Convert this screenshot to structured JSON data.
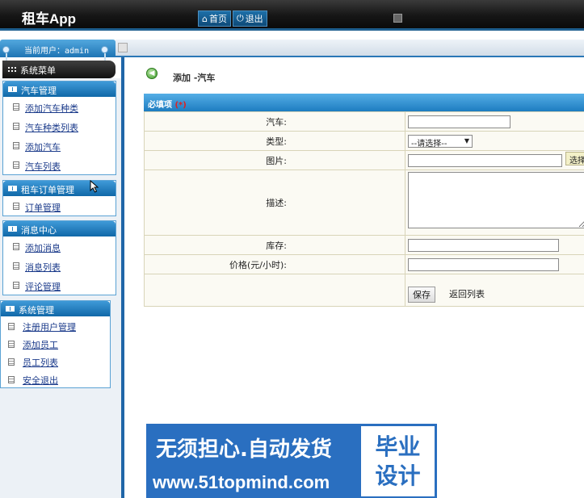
{
  "app": {
    "title": "租车App"
  },
  "topnav": {
    "home": "首页",
    "logout": "退出"
  },
  "user": {
    "label": "当前用户：admin"
  },
  "sidebar": {
    "title": "系统菜单",
    "groups": [
      {
        "title": "汽车管理",
        "items": [
          "添加汽车种类",
          "汽车种类列表",
          "添加汽车",
          "汽车列表"
        ]
      },
      {
        "title": "租车订单管理",
        "items": [
          "订单管理"
        ]
      },
      {
        "title": "消息中心",
        "items": [
          "添加消息",
          "消息列表",
          "评论管理"
        ]
      },
      {
        "title": "系统管理",
        "items": [
          "注册用户管理",
          "添加员工",
          "员工列表",
          "安全退出"
        ]
      }
    ]
  },
  "main": {
    "breadcrumb": "添加 -汽车",
    "required_title": "必填项",
    "required_mark": "(*)",
    "fields": {
      "car": "汽车:",
      "type": "类型:",
      "image": "图片:",
      "description": "描述:",
      "stock": "库存:",
      "price": "价格(元/小时):"
    },
    "type_select": "--请选择--",
    "pick_button": "选择",
    "save_button": "保存",
    "back_link": "返回列表"
  },
  "watermark": {
    "line1": "无须担心.自动发货",
    "line2": "www.51topmind.com",
    "badge_line1": "毕业",
    "badge_line2": "设计"
  },
  "colors": {
    "accent": "#1d7cc0",
    "header": "#161616",
    "watermark": "#2a6fc0"
  },
  "icons": {
    "home": "home-icon",
    "logout": "power-icon",
    "back": "back-arrow-icon",
    "menu": "grid-icon"
  }
}
